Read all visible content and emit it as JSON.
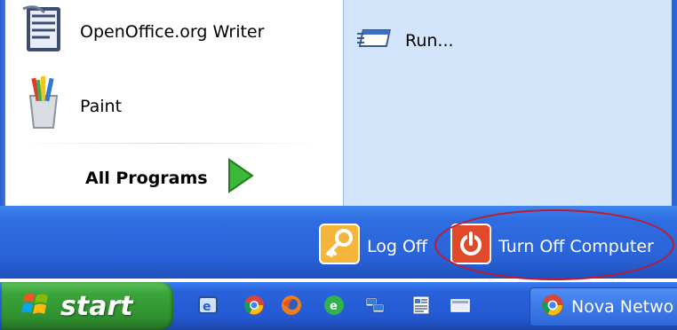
{
  "start_menu": {
    "programs": [
      {
        "label": "OpenOffice.org Writer",
        "icon": "openoffice-writer-icon"
      },
      {
        "label": "Paint",
        "icon": "paint-icon"
      }
    ],
    "all_programs_label": "All Programs",
    "right_items": [
      {
        "label": "Run...",
        "icon": "run-icon"
      }
    ],
    "footer": {
      "log_off_label": "Log Off",
      "turn_off_label": "Turn Off Computer"
    }
  },
  "taskbar": {
    "start_label": "start",
    "quick_launch": [
      "explorer-icon",
      "chrome-icon",
      "firefox-icon",
      "green-app-icon",
      "network-icon",
      "document-icon",
      "show-desktop-icon"
    ],
    "task_buttons": [
      {
        "label": "Nova Netwo",
        "icon": "chrome-icon"
      }
    ]
  },
  "colors": {
    "footer_blue": "#2a63d8",
    "start_green": "#3aa43a",
    "highlight_red": "#c4182a",
    "right_panel": "#d3e5fa"
  }
}
